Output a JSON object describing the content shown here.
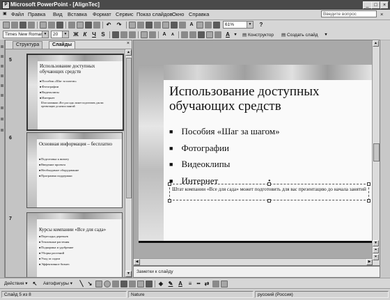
{
  "window": {
    "title": "Microsoft PowerPoint - [AlignTec]",
    "controls": [
      "_",
      "□",
      "×"
    ]
  },
  "menu": {
    "items": [
      "Файл",
      "Правка",
      "Вид",
      "Вставка",
      "Формат",
      "Сервис",
      "Показ слайдов",
      "Окно",
      "Справка"
    ],
    "help_placeholder": "Введите вопрос"
  },
  "format_toolbar": {
    "font": "Times New Roman",
    "size": "20",
    "bold": "Ж",
    "italic": "К",
    "underline": "Ч",
    "shadow": "S",
    "designer_label": "Конструктор",
    "new_slide_label": "Создать слайд"
  },
  "standard_toolbar": {
    "zoom": "61%"
  },
  "pane": {
    "tabs": [
      "Структура",
      "Слайды"
    ],
    "active_tab": "Слайды",
    "close": "×"
  },
  "thumbnails": [
    {
      "number": "5",
      "title": "Использование доступных обучающих средств",
      "bullets": [
        "Пособия «Шаг за шагом»",
        "Фотографии",
        "Видеоклипы",
        "Интернет"
      ],
      "note": "Штат компании «Все для сада» может подготовить для вас презентацию до начала занятий"
    },
    {
      "number": "6",
      "title": "Основная информация – бесплатно",
      "bullets": [
        "Подготовка к визиту",
        "Введение проекта",
        "Необходимое оборудование",
        "Программа поддержки"
      ]
    },
    {
      "number": "7",
      "title": "Курсы компании «Все для сада»",
      "bullets": [
        "Пересадка деревьев",
        "Тепличные растения",
        "Подкормка и удобрение",
        "Уборка растений",
        "Уход за садом",
        "Эффективное бизнес"
      ]
    }
  ],
  "slide": {
    "title": "Использование доступных обучающих средств",
    "bullets": [
      "Пособия «Шаг за шагом»",
      "Фотографии",
      "Видеоклипы",
      "Интернет"
    ],
    "textbox": "Штат компании «Все для сада» может подготовить для вас презентацию до начала занятий"
  },
  "notes": {
    "placeholder": "Заметки к слайду"
  },
  "drawing_toolbar": {
    "actions": "Действия",
    "autoshapes": "Автофигуры"
  },
  "status": {
    "slide": "Слайд 5 из 8",
    "design": "Nature",
    "language": "русский (Россия)"
  },
  "colors": {
    "title_bar": "#4a4a4a",
    "chrome": "#d6d6d6",
    "slide_background": "#fafafa"
  }
}
